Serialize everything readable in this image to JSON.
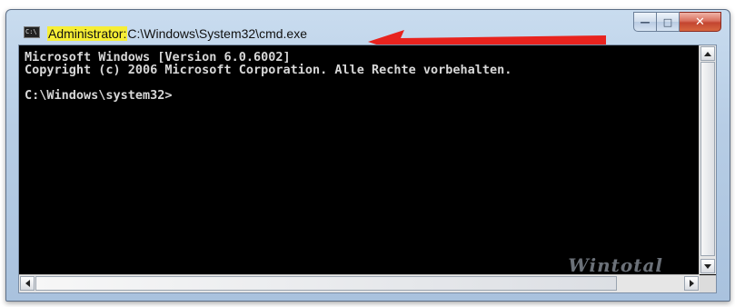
{
  "window": {
    "title_admin": "Administrator:",
    "title_path": "C:\\Windows\\System32\\cmd.exe",
    "icon_label": "C:\\",
    "minimize_glyph": "—",
    "maximize_glyph": "□",
    "close_glyph": "✕"
  },
  "console": {
    "lines": [
      "Microsoft Windows [Version 6.0.6002]",
      "Copyright (c) 2006 Microsoft Corporation. Alle Rechte vorbehalten.",
      "",
      "C:\\Windows\\system32>"
    ]
  },
  "watermark": "Wintotal",
  "colors": {
    "arrow": "#e8231e",
    "title_highlight": "#f6ee35",
    "console_background": "#000000",
    "console_text": "#d7d7d7"
  },
  "icons": {
    "app": "console-icon",
    "annotation": "red-arrow-left-icon",
    "scroll_up": "triangle-up-icon",
    "scroll_down": "triangle-down-icon",
    "scroll_left": "triangle-left-icon",
    "scroll_right": "triangle-right-icon"
  }
}
